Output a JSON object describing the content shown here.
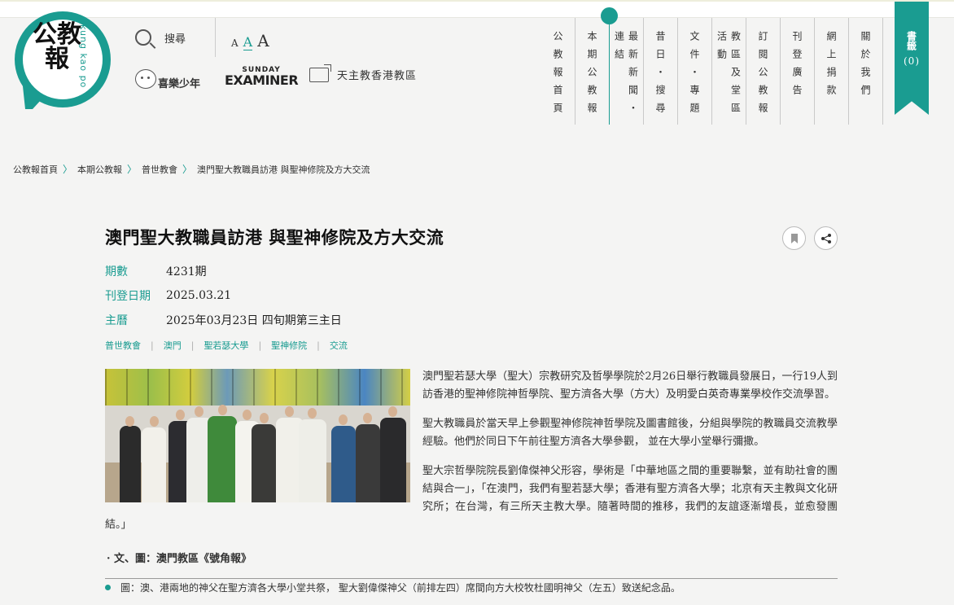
{
  "logo": {
    "glyph": "公教報",
    "roman": "kung kao po"
  },
  "search": {
    "label": "搜尋"
  },
  "font_size": {
    "small": "A",
    "medium": "A",
    "large": "A"
  },
  "sister_sites": [
    {
      "label": "喜樂少年"
    },
    {
      "top": "SUNDAY",
      "bottom": "EXAMINER"
    },
    {
      "label": "天主教香港教區"
    }
  ],
  "nav": [
    {
      "label": "公教報首頁"
    },
    {
      "label": "本期公教報"
    },
    {
      "label": "最新新聞・連結"
    },
    {
      "label": "昔日・搜尋"
    },
    {
      "label": "文件・專題"
    },
    {
      "label": "教區及堂區活動"
    },
    {
      "label": "訂閱公教報"
    },
    {
      "label": "刊登廣告"
    },
    {
      "label": "網上捐款"
    },
    {
      "label": "關於我們"
    }
  ],
  "bookmark_ribbon": {
    "label": "書籤",
    "count": "(0)"
  },
  "breadcrumb": [
    "公教報首頁",
    "本期公教報",
    "普世教會",
    "澳門聖大教職員訪港 與聖神修院及方大交流"
  ],
  "article": {
    "title": "澳門聖大教職員訪港 與聖神修院及方大交流",
    "meta": [
      {
        "key": "期數",
        "value": "4231期"
      },
      {
        "key": "刊登日期",
        "value": "2025.03.21"
      },
      {
        "key": "主曆",
        "value": "2025年03月23日 四旬期第三主日"
      }
    ],
    "tags": [
      "普世教會",
      "澳門",
      "聖若瑟大學",
      "聖神修院",
      "交流"
    ],
    "paragraphs": [
      "澳門聖若瑟大學（聖大）宗教研究及哲學學院於2月26日舉行教職員發展日，一行19人到訪香港的聖神修院神哲學院、聖方濟各大學（方大）及明愛白英奇專業學校作交流學習。",
      "聖大教職員於當天早上參觀聖神修院神哲學院及圖書館後，分組與學院的教職員交流教學經驗。他們於同日下午前往聖方濟各大學參觀， 並在大學小堂舉行彌撒。",
      "聖大宗哲學院院長劉偉傑神父形容，學術是「中華地區之間的重要聯繫，並有助社會的團結與合一」，「在澳門，我們有聖若瑟大學；香港有聖方濟各大學；北京有天主教與文化研究所；在台灣，有三所天主教大學。隨著時間的推移，我們的友誼逐漸增長，並愈發團結。」"
    ],
    "credit": "· 文、圖：澳門教區《號角報》",
    "caption": "圖：澳、港兩地的神父在聖方濟各大學小堂共祭， 聖大劉偉傑神父（前排左四）席間向方大校牧杜國明神父（左五）致送紀念品。"
  },
  "colors": {
    "accent": "#1a9c91",
    "background": "#f4f4f3"
  }
}
